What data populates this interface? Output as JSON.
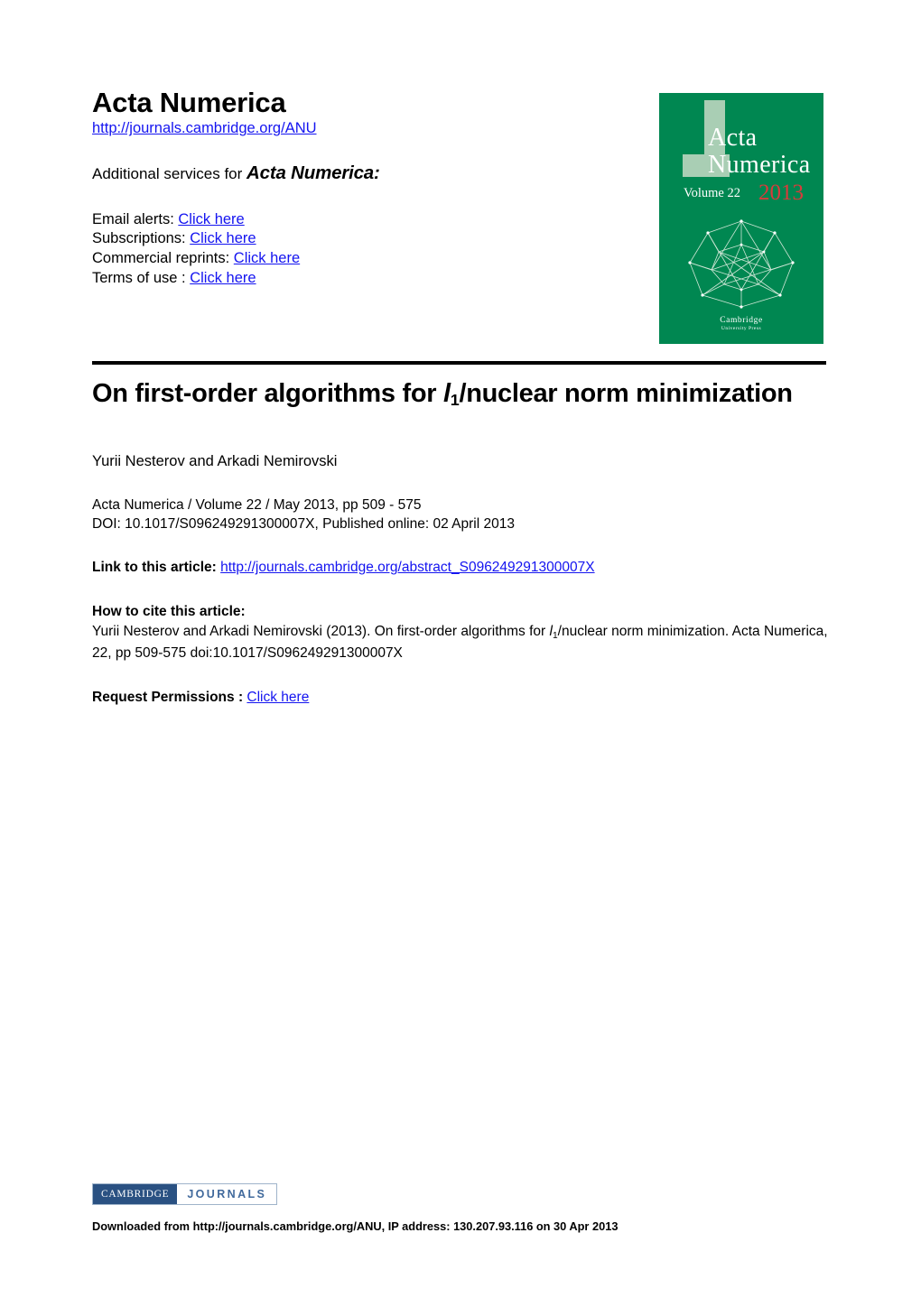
{
  "masthead": {
    "journal_title": "Acta Numerica",
    "journal_url": "http://journals.cambridge.org/ANU",
    "services_prefix": "Additional services for ",
    "services_journal": "Acta Numerica:",
    "services": [
      {
        "label": "Email alerts: ",
        "link": "Click here"
      },
      {
        "label": "Subscriptions: ",
        "link": "Click here"
      },
      {
        "label": "Commercial reprints: ",
        "link": "Click here"
      },
      {
        "label": "Terms of use : ",
        "link": "Click here"
      }
    ]
  },
  "cover": {
    "line1": "Acta",
    "line2": "Numerica",
    "volume": "Volume 22",
    "year": "2013",
    "publisher_line1": "Cambridge",
    "publisher_line2": "University Press",
    "background_color": "#008751",
    "accent_block_color": "#a9ceb4",
    "year_color": "#d93b3b"
  },
  "article": {
    "title_part1": "On first-order algorithms for ",
    "title_var": "l",
    "title_sub": "1",
    "title_part2": "/nuclear norm minimization",
    "authors": "Yurii Nesterov and Arkadi Nemirovski",
    "meta_line1": "Acta Numerica / Volume 22 / May 2013, pp 509 - 575",
    "meta_line2": "DOI: 10.1017/S096249291300007X, Published online: 02 April 2013",
    "link_label": "Link to this article: ",
    "link_url": "http://journals.cambridge.org/abstract_S096249291300007X",
    "cite_header": "How to cite this article:",
    "cite_part1": "Yurii Nesterov and Arkadi Nemirovski (2013). On first-order algorithms for ",
    "cite_var": "l",
    "cite_sub": "1",
    "cite_part2": "/nuclear norm minimization. Acta Numerica, 22, pp 509-575 doi:10.1017/S096249291300007X",
    "permissions_label": "Request Permissions : ",
    "permissions_link": "Click here"
  },
  "footer": {
    "logo_left": "Cambridge",
    "logo_right": "JOURNALS",
    "download_note": "Downloaded from http://journals.cambridge.org/ANU, IP address: 130.207.93.116 on 30 Apr 2013",
    "logo_left_bg": "#2a5182",
    "logo_right_fg": "#40699c"
  },
  "colors": {
    "link": "#1414f0",
    "text": "#000000",
    "rule": "#000000"
  }
}
